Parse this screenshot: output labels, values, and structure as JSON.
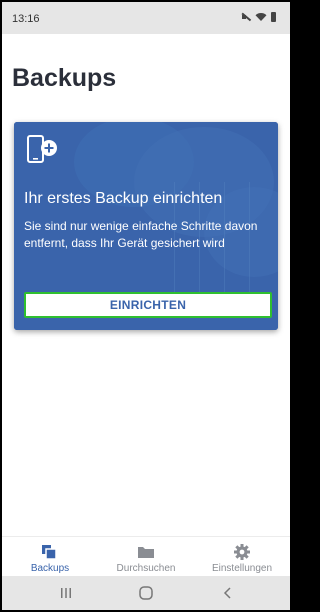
{
  "status_bar": {
    "time": "13:16",
    "icons": [
      "mute-icon",
      "wifi-icon",
      "battery-icon"
    ]
  },
  "page": {
    "title": "Backups"
  },
  "card": {
    "icon": "phone-add-icon",
    "title": "Ihr erstes Backup einrichten",
    "text": "Sie sind nur wenige einfache Schritte davon entfernt, dass Ihr Gerät gesichert wird",
    "button_label": "EINRICHTEN",
    "background_color": "#3a64ab",
    "button_border_color": "#2fbf2f"
  },
  "bottom_nav": {
    "items": [
      {
        "label": "Backups",
        "icon": "backups-icon",
        "active": true
      },
      {
        "label": "Durchsuchen",
        "icon": "folder-icon",
        "active": false
      },
      {
        "label": "Einstellungen",
        "icon": "gear-icon",
        "active": false
      }
    ],
    "active_color": "#3a64ab",
    "inactive_color": "#8a8d93"
  },
  "system_nav": {
    "buttons": [
      "recent-apps-icon",
      "home-icon",
      "back-icon"
    ]
  }
}
